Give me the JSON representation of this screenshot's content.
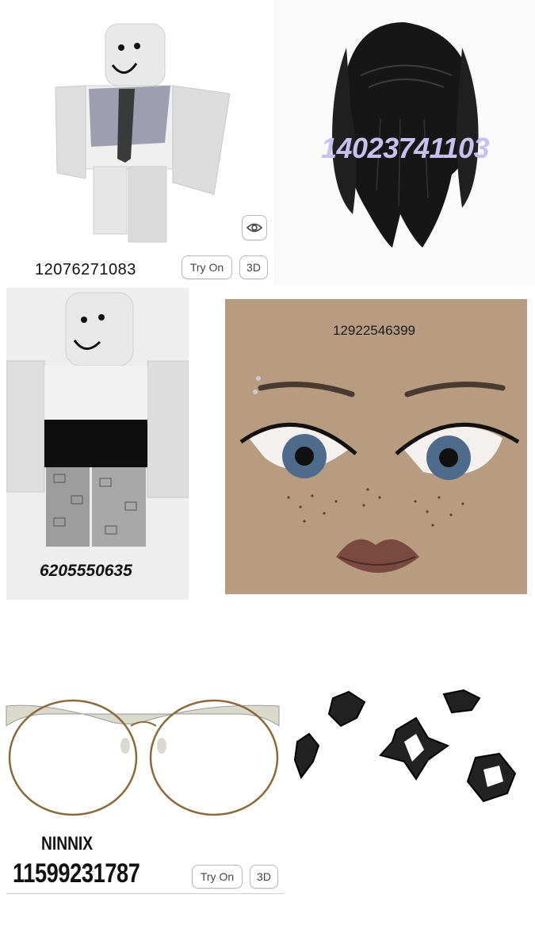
{
  "items": {
    "shirt_vest": {
      "id": "12076271083",
      "try_on_label": "Try On",
      "view_3d_label": "3D",
      "preview_icon": "eye-icon"
    },
    "black_hair": {
      "id": "14023741103"
    },
    "outfit_black": {
      "id": "6205550635"
    },
    "face": {
      "id": "12922546399"
    },
    "glasses": {
      "brand": "NINNIX",
      "id": "11599231787",
      "try_on_label": "Try On",
      "view_3d_label": "3D"
    },
    "star_clips": {}
  },
  "colors": {
    "hair_id": "#c8c0f0",
    "face_bg": "#b89c82",
    "button_border": "#b9b9b9"
  }
}
